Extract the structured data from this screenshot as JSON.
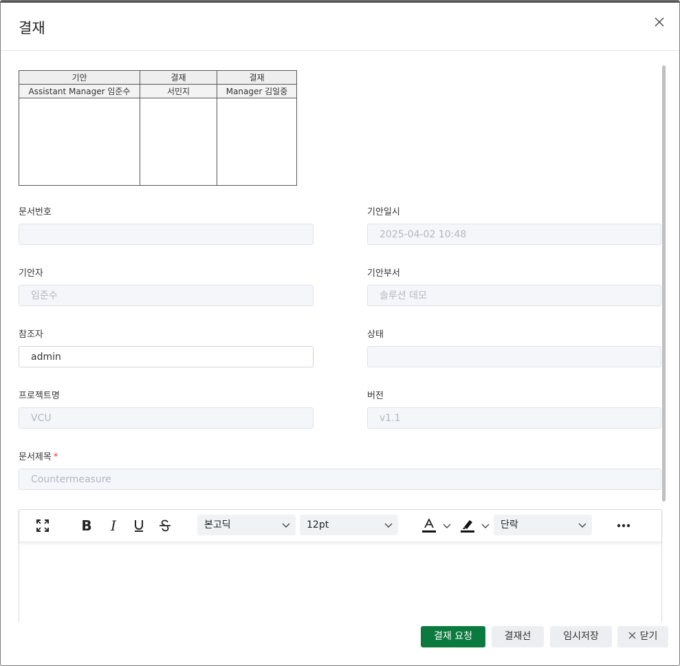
{
  "dialog": {
    "title": "결재",
    "close_icon": "close-icon"
  },
  "approval_table": {
    "headers": [
      "기안",
      "결재",
      "결재"
    ],
    "names": [
      "Assistant Manager 임준수",
      "서민지",
      "Manager 김일중"
    ]
  },
  "fields": {
    "doc_number": {
      "label": "문서번호",
      "value": ""
    },
    "draft_date": {
      "label": "기안일시",
      "value": "2025-04-02 10:48"
    },
    "drafter": {
      "label": "기안자",
      "value": "임준수"
    },
    "draft_dept": {
      "label": "기안부서",
      "value": "솔루션 데모"
    },
    "reference": {
      "label": "참조자",
      "value": "admin"
    },
    "status": {
      "label": "상태",
      "value": ""
    },
    "project": {
      "label": "프로젝트명",
      "value": "VCU"
    },
    "version": {
      "label": "버전",
      "value": "v1.1"
    },
    "doc_title": {
      "label": "문서제목",
      "required_mark": "*",
      "value": "Countermeasure"
    }
  },
  "editor": {
    "toolbar": {
      "font_family": "본고딕",
      "font_size": "12pt",
      "paragraph": "단락"
    }
  },
  "footer": {
    "request_approval": "결재 요청",
    "approval_line": "결재선",
    "save_draft": "임시저장",
    "close": "닫기"
  },
  "colors": {
    "primary": "#0b7a3e",
    "required": "#e0322b"
  }
}
